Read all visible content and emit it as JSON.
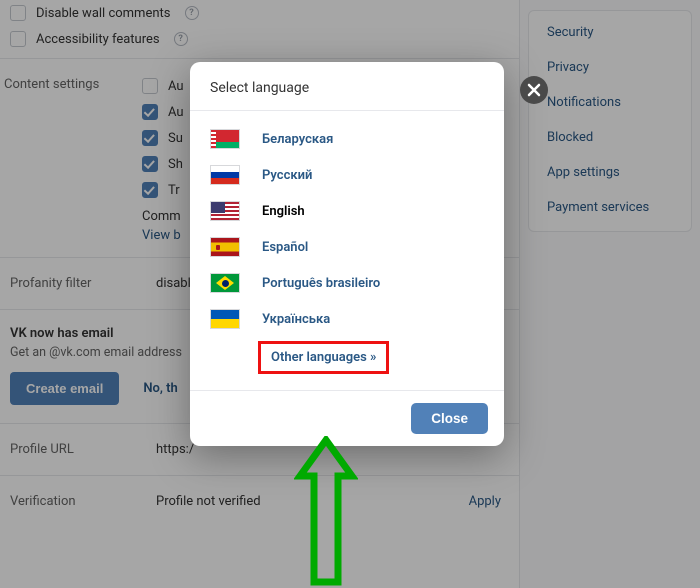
{
  "sidebar": {
    "items": [
      "Security",
      "Privacy",
      "Notifications",
      "Blocked",
      "App settings",
      "Payment services"
    ]
  },
  "top_checks": {
    "disable_wall": "Disable wall comments",
    "accessibility": "Accessibility features"
  },
  "content": {
    "label": "Content settings",
    "items": [
      "Au",
      "Au",
      "Su",
      "Sh",
      "Tr"
    ],
    "comm": "Comm",
    "view": "View b"
  },
  "profanity": {
    "label": "Profanity filter",
    "value": "disable"
  },
  "email": {
    "title": "VK now has email",
    "sub": "Get an @vk.com email address",
    "create": "Create email",
    "no": "No, th"
  },
  "profile_url": {
    "label": "Profile URL",
    "value": "https:/"
  },
  "verification": {
    "label": "Verification",
    "value": "Profile not verified",
    "action": "Apply"
  },
  "modal": {
    "title": "Select language",
    "languages": [
      {
        "code": "by",
        "name": "Беларуская"
      },
      {
        "code": "ru",
        "name": "Русский"
      },
      {
        "code": "us",
        "name": "English"
      },
      {
        "code": "es",
        "name": "Español"
      },
      {
        "code": "br",
        "name": "Português brasileiro"
      },
      {
        "code": "ua",
        "name": "Українська"
      }
    ],
    "other": "Other languages »",
    "close": "Close"
  }
}
